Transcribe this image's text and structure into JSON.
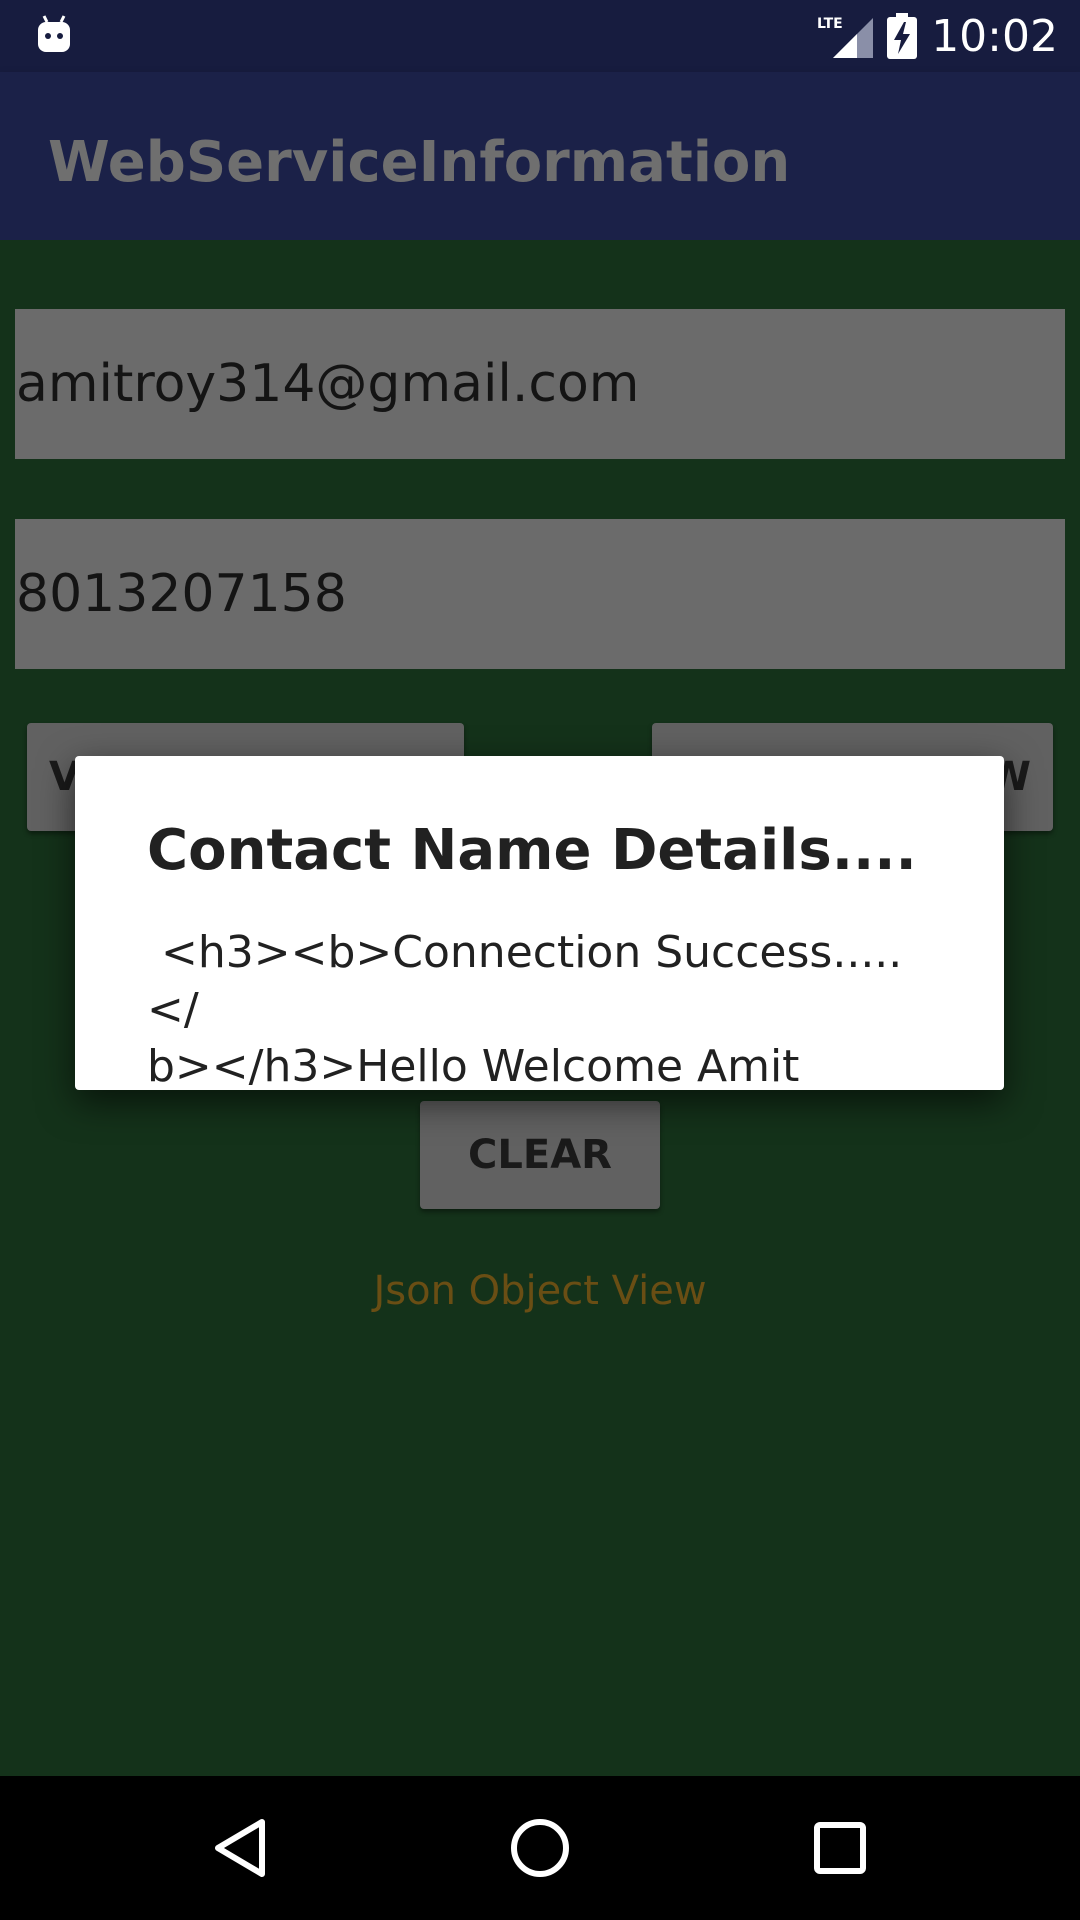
{
  "status_bar": {
    "time": "10:02",
    "network_label": "LTE",
    "icons": [
      "android-notification-icon",
      "lte-signal-icon",
      "battery-charging-icon"
    ]
  },
  "app_bar": {
    "title": "WebServiceInformation"
  },
  "form": {
    "email_value": "amitroy314@gmail.com",
    "phone_value": "8013207158"
  },
  "buttons": {
    "left_label_visible": "V",
    "right_label_visible": "W",
    "clear_label": "CLEAR"
  },
  "json_link": {
    "label": "Json Object View"
  },
  "dialog": {
    "title": "Contact Name Details....",
    "message": " <h3><b>Connection Success.....</\nb></h3>Hello Welcome Amit"
  },
  "nav_bar": {
    "icons": [
      "back-icon",
      "home-icon",
      "recents-icon"
    ]
  },
  "colors": {
    "status_bar": "#171c3f",
    "app_bar": "#1b2148",
    "background": "#14321a",
    "field": "#6b6b6b",
    "dialog": "#ffffff",
    "link": "#6a4e14"
  }
}
